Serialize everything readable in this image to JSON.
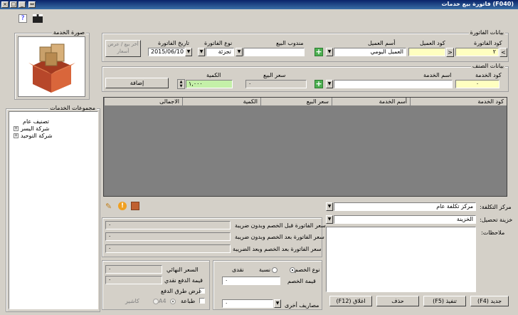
{
  "window": {
    "title": "(F040)  فاتورة بيع خدمات"
  },
  "invoice_group": {
    "caption": "بيانات الفاتورة",
    "invoice_code_label": "كود الفاتورة",
    "invoice_code": "٢",
    "client_code_label": "كود العميل",
    "client_code": "",
    "client_name_label": "أسم العميل",
    "client_name": "العميل اليومي",
    "sales_rep_label": "مندوب البيع",
    "sales_rep": "",
    "invoice_type_label": "نوع الفاتورة",
    "invoice_type": "تجزئة",
    "invoice_date_label": "تاريخ الفاتورة",
    "invoice_date": "2015/06/10",
    "show_prices_btn": "أخر بيع / عرض أسعار"
  },
  "item_group": {
    "caption": "بيانات الصنف",
    "service_code_label": "كود الخدمة",
    "service_code": "٠",
    "service_name_label": "اسم الخدمة",
    "service_name": "",
    "sale_price_label": "سعر البيع",
    "sale_price": "٠",
    "quantity_label": "الكمية",
    "quantity": "١,٠٠٠",
    "add_btn": "إضافة"
  },
  "service_image": {
    "caption": "صورة الخدمة"
  },
  "service_groups": {
    "caption": "مجموعات الخدمات",
    "items": [
      {
        "label": "تصنيف عام",
        "expander": ""
      },
      {
        "label": "شركة اليسر",
        "expander": "+"
      },
      {
        "label": "شركة التوحيد",
        "expander": "+"
      }
    ]
  },
  "grid": {
    "columns": [
      "كود الخدمة",
      "أسم الخدمة",
      "سعر البيع",
      "الكمية",
      "الاجمالى"
    ]
  },
  "cost_center": {
    "label": "مركز التكلفة:",
    "value": "مركز تكلفة عام"
  },
  "collection_treasury": {
    "label": "خزينة تحصيل:",
    "value": "الخزينة"
  },
  "notes": {
    "label": "ملاحظات:"
  },
  "totals": {
    "before_discount_label": "سعر الفاتورة قبل الخصم وبدون ضريبة",
    "after_discount_label": "سعر الفاتورة بعد الخصم وبدون ضريبة",
    "after_discount_tax_label": "سعر الفاتورة بعد الخصم وبعد الضريبة",
    "before_discount": "٠",
    "after_discount": "٠",
    "after_discount_tax": "٠"
  },
  "discount": {
    "type_label": "نوع الخصم",
    "percent_label": "نسبة",
    "cash_label": "نقدى",
    "value_label": "قيمة الخصم",
    "value": "٠",
    "other_expenses_label": "مصاريف أخرى",
    "other_expenses": "٠"
  },
  "final": {
    "final_price_label": "السعر النهائي",
    "final_price": "٠",
    "cash_paid_label": "قيمة الدفع نقدي",
    "cash_paid": "٠",
    "show_payment_label": "عرض طرق الدفع",
    "print_label": "طباعة",
    "a4_label": "A4",
    "cashier_label": "كاشير"
  },
  "buttons": {
    "new": "جديد (F4)",
    "execute": "تنفيذ (F5)",
    "delete": "حذف",
    "close": "اغلاق (F12)"
  },
  "colors": {
    "title_start": "#0a246a",
    "title_end": "#3a6ea5",
    "field_yellow": "#ffffc0",
    "field_green": "#c4f0a8",
    "plus_green": "#4caf50"
  }
}
